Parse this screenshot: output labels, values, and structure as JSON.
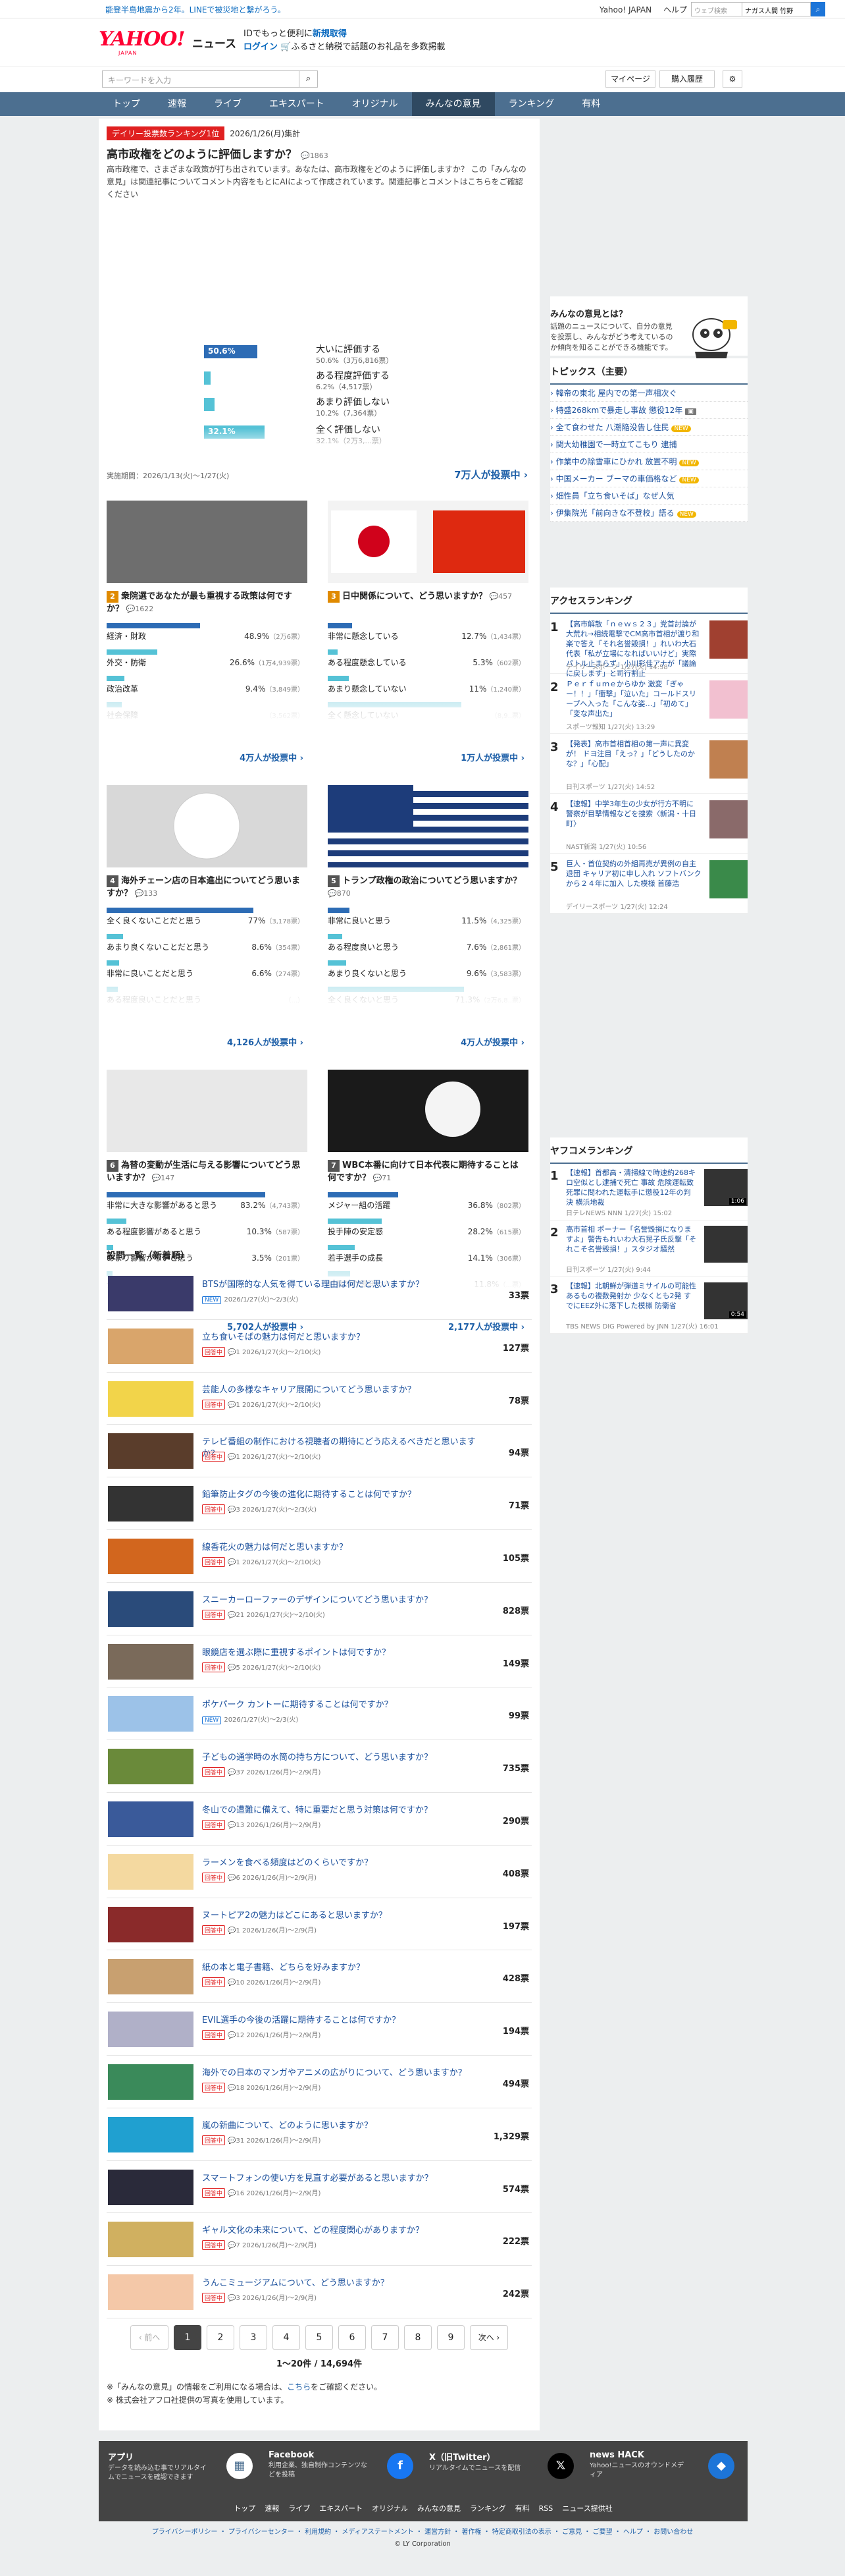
{
  "topbar": {
    "notice": "能登半島地震から2年。LINEで被災地と繋がろう。",
    "links": [
      "Yahoo! JAPAN",
      "ヘルプ"
    ],
    "web_search_placeholder": "ウェブ検索",
    "web_search_term": "ナガス人間 竹野"
  },
  "logo": {
    "brand": "YAHOO!",
    "sub": "JAPAN",
    "service": "ニュース"
  },
  "promo": {
    "line1_a": "IDでもっと便利に",
    "line1_b": "新規取得",
    "line2_a": "ログイン",
    "line2_b": "ふるさと納税で話題のお礼品を多数掲載"
  },
  "search": {
    "placeholder": "キーワードを入力",
    "mypage": "マイページ",
    "history": "購入履歴"
  },
  "gnav": [
    "トップ",
    "速報",
    "ライブ",
    "エキスパート",
    "オリジナル",
    "みんなの意見",
    "ランキング",
    "有料"
  ],
  "featured": {
    "tag": "デイリー投票数ランキング1位",
    "date": "2026/1/26(月)集計",
    "rank": "1",
    "question": "高市政権をどのように評価しますか？",
    "comments": "1863",
    "desc": "高市政権で、さまざまな政策が打ち出されています。あなたは、高市政権をどのように評価しますか？ この「みんなの意見」は関連記事についてコメント内容をもとにAIによって作成されています。関連記事とコメントはこちらをご確認ください",
    "options": [
      {
        "label": "大いに評価する",
        "pct": "50.6%",
        "sub": "50.6%（3万6,816票）",
        "v": 50.6
      },
      {
        "label": "ある程度評価する",
        "pct": "",
        "sub": "6.2%（4,517票）",
        "v": 6.2
      },
      {
        "label": "あまり評価しない",
        "pct": "",
        "sub": "10.2%（7,364票）",
        "v": 10.2
      },
      {
        "label": "全く評価しない",
        "pct": "32.1%",
        "sub": "32.1%（2万3,...票）",
        "v": 32.1
      }
    ],
    "period": "実施期間：2026/1/13(火)〜1/27(火)",
    "votes": "7万人が投票中 ›"
  },
  "cards": [
    {
      "num": "2",
      "q": "衆院選であなたが最も重視する政策は何ですか？",
      "cnt": "1622",
      "rows": [
        [
          "経済・財政",
          "48.9%",
          "2万6票"
        ],
        [
          "外交・防衛",
          "26.6%",
          "1万4,939票"
        ],
        [
          "政治改革",
          "9.4%",
          "3,849票"
        ],
        [
          "社会保障",
          "",
          "3,562票"
        ]
      ],
      "vals": [
        48.9,
        26.6,
        9.4,
        8
      ],
      "votes": "4万人が投票中 ›"
    },
    {
      "num": "3",
      "q": "日中関係について、どう思いますか？",
      "cnt": "457",
      "rows": [
        [
          "非常に懸念している",
          "12.7%",
          "1,434票"
        ],
        [
          "ある程度懸念している",
          "5.3%",
          "602票"
        ],
        [
          "あまり懸念していない",
          "11%",
          "1,240票"
        ],
        [
          "全く懸念していない",
          "",
          "8,9..票"
        ]
      ],
      "vals": [
        12.7,
        5.3,
        11,
        70
      ],
      "votes": "1万人が投票中 ›"
    },
    {
      "num": "4",
      "q": "海外チェーン店の日本進出についてどう思いますか？",
      "cnt": "133",
      "rows": [
        [
          "全く良くないことだと思う",
          "77%",
          "3,178票"
        ],
        [
          "あまり良くないことだと思う",
          "8.6%",
          "354票"
        ],
        [
          "非常に良いことだと思う",
          "6.6%",
          "274票"
        ],
        [
          "ある程度良いことだと思う",
          "",
          "..."
        ]
      ],
      "vals": [
        77,
        8.6,
        6.6,
        6
      ],
      "votes": "4,126人が投票中 ›"
    },
    {
      "num": "5",
      "q": "トランプ政権の政治についてどう思いますか？",
      "cnt": "870",
      "rows": [
        [
          "非常に良いと思う",
          "11.5%",
          "4,325票"
        ],
        [
          "ある程度良いと思う",
          "7.6%",
          "2,861票"
        ],
        [
          "あまり良くないと思う",
          "9.6%",
          "3,583票"
        ],
        [
          "全く良くないと思う",
          "71.3%",
          "2万6,8..票"
        ]
      ],
      "vals": [
        11.5,
        7.6,
        9.6,
        71.3
      ],
      "votes": "4万人が投票中 ›"
    },
    {
      "num": "6",
      "q": "為替の変動が生活に与える影響についてどう思いますか？",
      "cnt": "147",
      "rows": [
        [
          "非常に大きな影響があると思う",
          "83.2%",
          "4,743票"
        ],
        [
          "ある程度影響があると思う",
          "10.3%",
          "587票"
        ],
        [
          "あまり影響がないと思う",
          "3.5%",
          "201票"
        ],
        [
          "全く影響がないと思う",
          "",
          "..."
        ]
      ],
      "vals": [
        83.2,
        10.3,
        3.5,
        3
      ],
      "votes": "5,702人が投票中 ›"
    },
    {
      "num": "7",
      "q": "WBC本番に向けて日本代表に期待することは何ですか？",
      "cnt": "71",
      "rows": [
        [
          "メジャー組の活躍",
          "36.8%",
          "802票"
        ],
        [
          "投手陣の安定感",
          "28.2%",
          "615票"
        ],
        [
          "若手選手の成長",
          "14.1%",
          "306票"
        ],
        [
          "打撃陣の爆発力向上",
          "11.8%",
          "...票"
        ]
      ],
      "vals": [
        36.8,
        28.2,
        14.1,
        11.8
      ],
      "votes": "2,177人が投票中 ›"
    }
  ],
  "list_title": "設問一覧（新着順）",
  "list": [
    {
      "q": "BTSが国際的な人気を得ている理由は何だと思いますか？",
      "m": "2026/1/27(火)〜2/3(火)",
      "v": "33票",
      "new": true,
      "c": ""
    },
    {
      "q": "立ち食いそばの魅力は何だと思いますか？",
      "m": "2026/1/27(火)〜2/10(火)",
      "v": "127票",
      "new": false,
      "c": "1"
    },
    {
      "q": "芸能人の多様なキャリア展開についてどう思いますか？",
      "m": "2026/1/27(火)〜2/10(火)",
      "v": "78票",
      "new": false,
      "c": "1"
    },
    {
      "q": "テレビ番組の制作における視聴者の期待にどう応えるべきだと思いますか？",
      "m": "2026/1/27(火)〜2/10(火)",
      "v": "94票",
      "new": false,
      "c": "1"
    },
    {
      "q": "鉛筆防止タグの今後の進化に期待することは何ですか？",
      "m": "2026/1/27(火)〜2/3(火)",
      "v": "71票",
      "new": false,
      "c": "3"
    },
    {
      "q": "線香花火の魅力は何だと思いますか？",
      "m": "2026/1/27(火)〜2/10(火)",
      "v": "105票",
      "new": false,
      "c": "1"
    },
    {
      "q": "スニーカーローファーのデザインについてどう思いますか？",
      "m": "2026/1/27(火)〜2/10(火)",
      "v": "828票",
      "new": false,
      "c": "21"
    },
    {
      "q": "眼鏡店を選ぶ際に重視するポイントは何ですか？",
      "m": "2026/1/27(火)〜2/10(火)",
      "v": "149票",
      "new": false,
      "c": "5"
    },
    {
      "q": "ポケパーク カントーに期待することは何ですか？",
      "m": "2026/1/27(火)〜2/3(火)",
      "v": "99票",
      "new": true,
      "c": ""
    },
    {
      "q": "子どもの通学時の水筒の持ち方について、どう思いますか？",
      "m": "2026/1/26(月)〜2/9(月)",
      "v": "735票",
      "new": false,
      "c": "37"
    },
    {
      "q": "冬山での遭難に備えて、特に重要だと思う対策は何ですか？",
      "m": "2026/1/26(月)〜2/9(月)",
      "v": "290票",
      "new": false,
      "c": "13"
    },
    {
      "q": "ラーメンを食べる頻度はどのくらいですか？",
      "m": "2026/1/26(月)〜2/9(月)",
      "v": "408票",
      "new": false,
      "c": "6"
    },
    {
      "q": "ヌートピア2の魅力はどこにあると思いますか？",
      "m": "2026/1/26(月)〜2/9(月)",
      "v": "197票",
      "new": false,
      "c": "1"
    },
    {
      "q": "紙の本と電子書籍、どちらを好みますか？",
      "m": "2026/1/26(月)〜2/9(月)",
      "v": "428票",
      "new": false,
      "c": "10"
    },
    {
      "q": "EVIL選手の今後の活躍に期待することは何ですか？",
      "m": "2026/1/26(月)〜2/9(月)",
      "v": "194票",
      "new": false,
      "c": "12"
    },
    {
      "q": "海外での日本のマンガやアニメの広がりについて、どう思いますか？",
      "m": "2026/1/26(月)〜2/9(月)",
      "v": "494票",
      "new": false,
      "c": "18"
    },
    {
      "q": "嵐の新曲について、どのように思いますか？",
      "m": "2026/1/26(月)〜2/9(月)",
      "v": "1,329票",
      "new": false,
      "c": "31"
    },
    {
      "q": "スマートフォンの使い方を見直す必要があると思いますか？",
      "m": "2026/1/26(月)〜2/9(月)",
      "v": "574票",
      "new": false,
      "c": "16"
    },
    {
      "q": "ギャル文化の未来について、どの程度関心がありますか？",
      "m": "2026/1/26(月)〜2/9(月)",
      "v": "222票",
      "new": false,
      "c": "7"
    },
    {
      "q": "うんこミュージアムについて、どう思いますか？",
      "m": "2026/1/26(月)〜2/9(月)",
      "v": "242票",
      "new": false,
      "c": "3"
    }
  ],
  "pager": {
    "prev": "‹ 前へ",
    "pages": [
      "1",
      "2",
      "3",
      "4",
      "5",
      "6",
      "7",
      "8",
      "9"
    ],
    "next": "次へ ›",
    "range": "1〜20件 / 14,694件"
  },
  "notes": {
    "n1a": "※「みんなの意見」の情報をご利用になる場合は、",
    "n1b": "こちら",
    "n1c": "をご確認ください。",
    "n2": "※ 株式会社アフロ社提供の写真を使用しています。"
  },
  "side": {
    "about_title": "みんなの意見とは？",
    "about_desc": "話題のニュースについて、自分の意見を投票し、みんながどう考えているのか傾向を知ることができる機能です。",
    "topics_title": "トピックス（主要）",
    "topics": [
      {
        "t": "韓帝の東北 屋内での第一声相次ぐ",
        "i": ""
      },
      {
        "t": "特盛268kmで暴走し事故 懲役12年",
        "i": "pic"
      },
      {
        "t": "全て食わせた 八潮陥没告し住民",
        "i": "new"
      },
      {
        "t": "関大幼稚園で一時立てこもり 逮捕",
        "i": ""
      },
      {
        "t": "作業中の除雪車にひかれ 放置不明",
        "i": "new"
      },
      {
        "t": "中国メーカー ブーマの車価格など",
        "i": "new"
      },
      {
        "t": "畑性員「立ち食いそば」なぜ人気",
        "i": ""
      },
      {
        "t": "伊集院光「前向きな不登校」語る",
        "i": "new"
      }
    ],
    "access_title": "アクセスランキング",
    "access": [
      {
        "n": "1",
        "t": "【高市解散「ｎｅｗｓ２３」党首討論が大荒れ→相続電撃でCM高市首相が渡り和楽で答え「それ名誉毀損！」れいわ大石代表「私が立場になればいいけど」実際パトル止まらず」小川彩佳アナが「議論に戻します」と司行割止",
        "s": "デイリースポーツ 1/27(火) 14:58"
      },
      {
        "n": "2",
        "t": "Ｐｅｒｆｕｍｅからゆか 激変「ぎゃー！！」「衝撃」「泣いた」コールドスリープへ入った「こんな姿…」「初めて」「変な声出た」",
        "s": "スポーツ報知 1/27(火) 13:29"
      },
      {
        "n": "3",
        "t": "【発表】高市首相首相の第一声に異変が！ ドヨ注目「えっ？」「どうしたのかな？」「心配」",
        "s": "日刊スポーツ 1/27(火) 14:52"
      },
      {
        "n": "4",
        "t": "【速報】中学3年生の少女が行方不明に 警察が目撃情報などを捜索〈新潟・十日町〉",
        "s": "NAST新潟 1/27(火) 10:56"
      },
      {
        "n": "5",
        "t": "巨人・首位契約の外組再売が異例の自主退団 キャリア初に申し入れ ソフトバンクから２４年に加入 した模様 首藤浩",
        "s": "デイリースポーツ 1/27(火) 12:24"
      }
    ],
    "yrank_title": "ヤフコメランキング",
    "yrank": [
      {
        "n": "1",
        "t": "【速報】首都高・清掃線で時速約268キロ空似とし逮捕で死亡 事故 危険運転致死罪に問われた運転手に懲役12年の判決 横浜地裁",
        "s": "日テレNEWS NNN 1/27(火) 15:02",
        "d": "1:06"
      },
      {
        "n": "2",
        "t": "高市首相 ポーナー「名誉毀損になりますよ」警告もれいわ大石晃子氏反撃「それこそ名誉毀損！」スタジオ騒然",
        "s": "日刊スポーツ 1/27(火) 9:44",
        "d": ""
      },
      {
        "n": "3",
        "t": "【速報】北朝鮮が弾道ミサイルの可能性あるもの複数発射か 少なくとも2発 すでにEEZ外に落下した模様 防衛省",
        "s": "TBS NEWS DIG Powered by JNN 1/27(火) 16:01",
        "d": "0:54"
      }
    ]
  },
  "footer": {
    "blocks": [
      {
        "h": "アプリ",
        "s": "データを読み込む事でリアルタイムでニュースを確認できます"
      },
      {
        "h": "Facebook",
        "s": "利用企業、独自制作コンテンツなどを投稿"
      },
      {
        "h": "X（旧Twitter）",
        "s": "リアルタイムでニュースを配信"
      },
      {
        "h": "news HACK",
        "s": "Yahoo!ニュースのオウンドメディア"
      }
    ],
    "nav": [
      "トップ",
      "速報",
      "ライブ",
      "エキスパート",
      "オリジナル",
      "みんなの意見",
      "ランキング",
      "有料",
      "RSS",
      "ニュース提供社"
    ],
    "legal": "プライバシーポリシー ・ プライバシーセンター ・ 利用規約 ・ メディアステートメント ・ 運営方針 ・ 著作権 ・ 特定商取引法の表示 ・ ご意見 ・ ご要望 ・ ヘルプ ・ お問い合わせ",
    "copyright": "© LY Corporation"
  },
  "colors": {
    "brand_red": "#ff0033",
    "nav_blue": "#4c6f90",
    "bar_dark": "#2d6cb5",
    "bar_light": "#55c2d6",
    "link": "#1a4f9c"
  }
}
